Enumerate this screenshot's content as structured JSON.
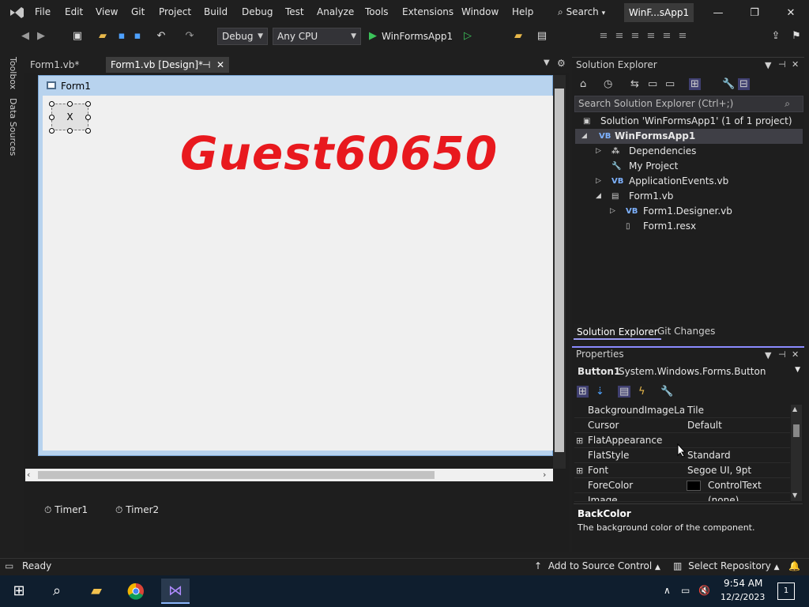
{
  "menu": {
    "items": [
      "File",
      "Edit",
      "View",
      "Git",
      "Project",
      "Build",
      "Debug",
      "Test",
      "Analyze",
      "Tools",
      "Extensions",
      "Window",
      "Help"
    ],
    "search_label": "Search",
    "solution_name": "WinF...sApp1"
  },
  "window_controls": {
    "minimize": "—",
    "maximize": "❐",
    "close": "✕"
  },
  "toolbar": {
    "config": "Debug",
    "platform": "Any CPU",
    "run_target": "WinFormsApp1"
  },
  "side_tabs": [
    "Toolbox",
    "Data Sources"
  ],
  "doc_tabs": {
    "code": "Form1.vb*",
    "design": "Form1.vb [Design]*"
  },
  "designer": {
    "form_title": "Form1",
    "button_text": "X",
    "label_text": "Guest60650",
    "label_color": "#e8191e",
    "tray": [
      "Timer1",
      "Timer2"
    ]
  },
  "solution_explorer": {
    "title": "Solution Explorer",
    "search_placeholder": "Search Solution Explorer (Ctrl+;)",
    "tree": [
      {
        "label": "Solution 'WinFormsApp1' (1 of 1 project)",
        "icon": "solution-icon"
      },
      {
        "label": "WinFormsApp1",
        "icon": "vb-project-icon"
      },
      {
        "label": "Dependencies",
        "icon": "dependencies-icon"
      },
      {
        "label": "My Project",
        "icon": "wrench-icon"
      },
      {
        "label": "ApplicationEvents.vb",
        "icon": "vb-file-icon"
      },
      {
        "label": "Form1.vb",
        "icon": "form-icon"
      },
      {
        "label": "Form1.Designer.vb",
        "icon": "vb-file-icon"
      },
      {
        "label": "Form1.resx",
        "icon": "resx-file-icon"
      }
    ],
    "tabs": [
      "Solution Explorer",
      "Git Changes"
    ]
  },
  "properties": {
    "title": "Properties",
    "object_name": "Button1",
    "object_type": "System.Windows.Forms.Button",
    "rows": [
      {
        "name": "BackgroundImageLayo",
        "value": "Tile"
      },
      {
        "name": "Cursor",
        "value": "Default"
      },
      {
        "name": "FlatAppearance",
        "value": ""
      },
      {
        "name": "FlatStyle",
        "value": "Standard"
      },
      {
        "name": "Font",
        "value": "Segoe UI, 9pt"
      },
      {
        "name": "ForeColor",
        "value": "ControlText"
      },
      {
        "name": "Image",
        "value": "(none)"
      }
    ],
    "fore_color_swatch": "#000000",
    "desc_title": "BackColor",
    "desc_text": "The background color of the component."
  },
  "status": {
    "ready": "Ready",
    "source_control": "Add to Source Control",
    "repository": "Select Repository"
  },
  "taskbar": {
    "time": "9:54 AM",
    "date": "12/2/2023",
    "notifications": "1"
  }
}
